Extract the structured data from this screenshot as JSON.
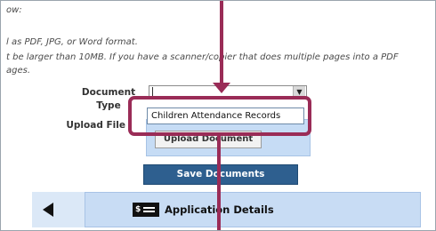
{
  "instructions": {
    "line1": "ow:",
    "line2": "l as PDF, JPG, or Word format.",
    "line3": "t be larger than 10MB. If you have a scanner/copier that does multiple pages into a PDF",
    "line4": "ages."
  },
  "form": {
    "document_type_label_1": "Document",
    "document_type_label_2": "Type",
    "upload_file_label": "Upload File",
    "upload_button": "Upload Document",
    "save_button": "Save Documents"
  },
  "dropdown": {
    "selected_value": "",
    "option": "Children Attendance Records"
  },
  "navigation": {
    "title": "Application Details",
    "money_icon_text": "$"
  },
  "colors": {
    "highlight": "#9a2c57",
    "save_button": "#2e5f8f",
    "panel": "#c8dcf4"
  }
}
